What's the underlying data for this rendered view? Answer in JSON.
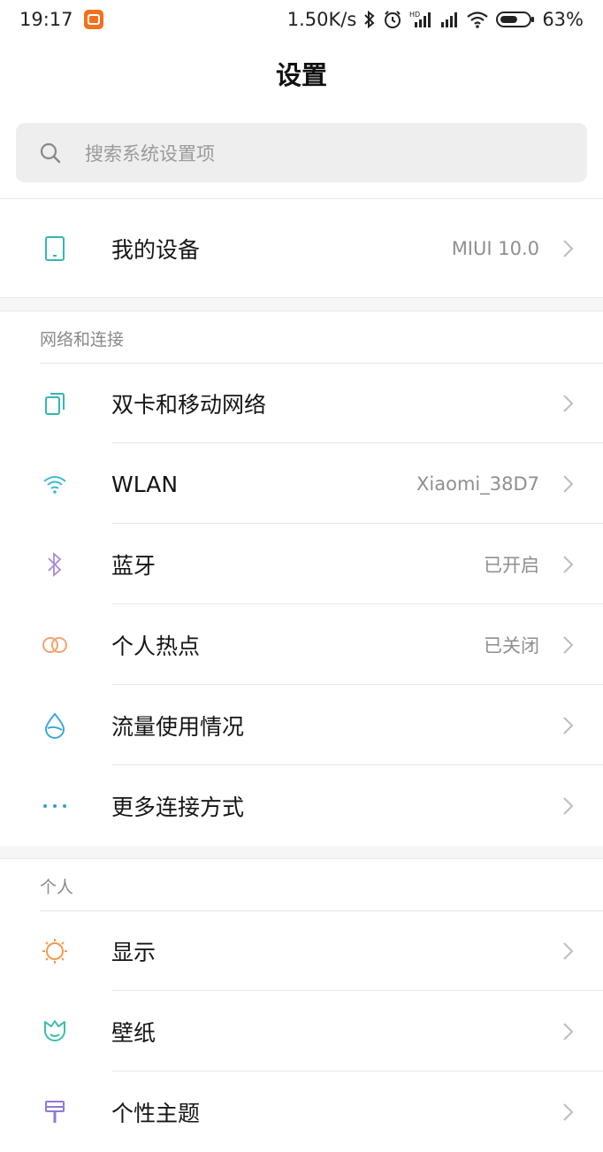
{
  "status_bar": {
    "time": "19:17",
    "speed": "1.50K/s",
    "battery": "63%",
    "battery_level": 0.63,
    "icons": [
      "app-badge-icon",
      "bluetooth-icon",
      "alarm-icon",
      "hd-signal-icon",
      "signal-icon",
      "wifi-icon",
      "battery-icon"
    ]
  },
  "header": {
    "title": "设置"
  },
  "search": {
    "placeholder": "搜索系统设置项",
    "icon": "search-icon"
  },
  "device": {
    "label": "我的设备",
    "value": "MIUI 10.0",
    "icon": "phone-icon"
  },
  "sections": [
    {
      "title": "网络和连接",
      "items": [
        {
          "label": "双卡和移动网络",
          "value": "",
          "icon": "sim-card-icon"
        },
        {
          "label": "WLAN",
          "value": "Xiaomi_38D7",
          "icon": "wifi-icon"
        },
        {
          "label": "蓝牙",
          "value": "已开启",
          "icon": "bluetooth-icon"
        },
        {
          "label": "个人热点",
          "value": "已关闭",
          "icon": "hotspot-icon"
        },
        {
          "label": "流量使用情况",
          "value": "",
          "icon": "data-drop-icon"
        },
        {
          "label": "更多连接方式",
          "value": "",
          "icon": "more-dots-icon"
        }
      ]
    },
    {
      "title": "个人",
      "items": [
        {
          "label": "显示",
          "value": "",
          "icon": "sun-icon"
        },
        {
          "label": "壁纸",
          "value": "",
          "icon": "tulip-icon"
        },
        {
          "label": "个性主题",
          "value": "",
          "icon": "brush-icon"
        }
      ]
    }
  ],
  "colors": {
    "teal": "#35b6b0",
    "wifi_blue": "#38b9d9",
    "bluetooth_purple": "#a88ad8",
    "hotspot_orange": "#f2a36f",
    "drop_blue": "#3aa9d8",
    "dots_blue": "#3a9ad8",
    "sun_orange": "#f29a4e",
    "tulip_teal": "#3cbfa8",
    "brush_purple": "#8f7ad8"
  }
}
